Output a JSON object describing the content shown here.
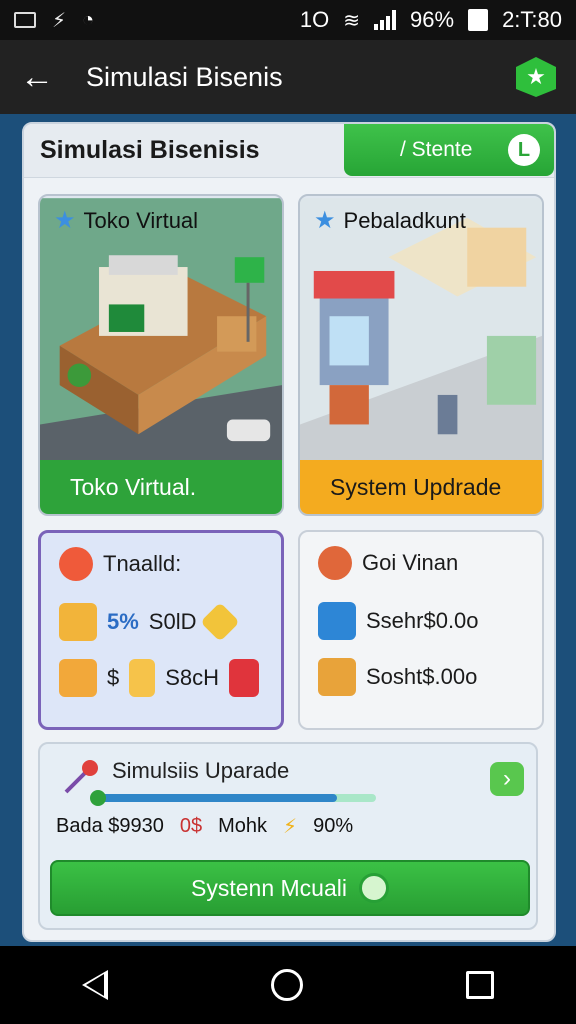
{
  "status_bar": {
    "icons_left": [
      "image-icon",
      "bolt-icon",
      "clock-icon"
    ],
    "signal_text": "1O",
    "battery": "96%",
    "time": "2:T:80"
  },
  "app_bar": {
    "back_icon": "arrow-left-icon",
    "title": "Simulasi Bisenis",
    "badge_icon": "star-shield-icon"
  },
  "panel": {
    "title": "Simulasi Bisenisis",
    "status_label": "/ Stente",
    "status_icon_text": "L"
  },
  "cards": {
    "virtual_store": {
      "caption": "Toko Virtual",
      "footer": "Toko Virtual."
    },
    "update": {
      "caption": "Pebaladkunt",
      "footer": "System Updrade"
    }
  },
  "trading": {
    "title": "Tnaalld:",
    "row1_value": "5%",
    "row1_label": "S0lD",
    "row2_value": "$",
    "row2_label": "S8cH"
  },
  "gain": {
    "title": "Goi Vinan",
    "row1": "Ssehr$0.0o",
    "row2": "Sosht$.00o"
  },
  "upgrade": {
    "title": "Simulsiis Uparade",
    "progress": 0.86,
    "stat_bada": "Bada $9930",
    "stat_red": "0$",
    "stat_mohk": "Mohk",
    "stat_pct": "90%",
    "cta_label": "Systenn Mcuali"
  },
  "colors": {
    "accent_green": "#2ea33a",
    "accent_orange": "#f4ab1f",
    "accent_blue": "#2f86c8"
  }
}
